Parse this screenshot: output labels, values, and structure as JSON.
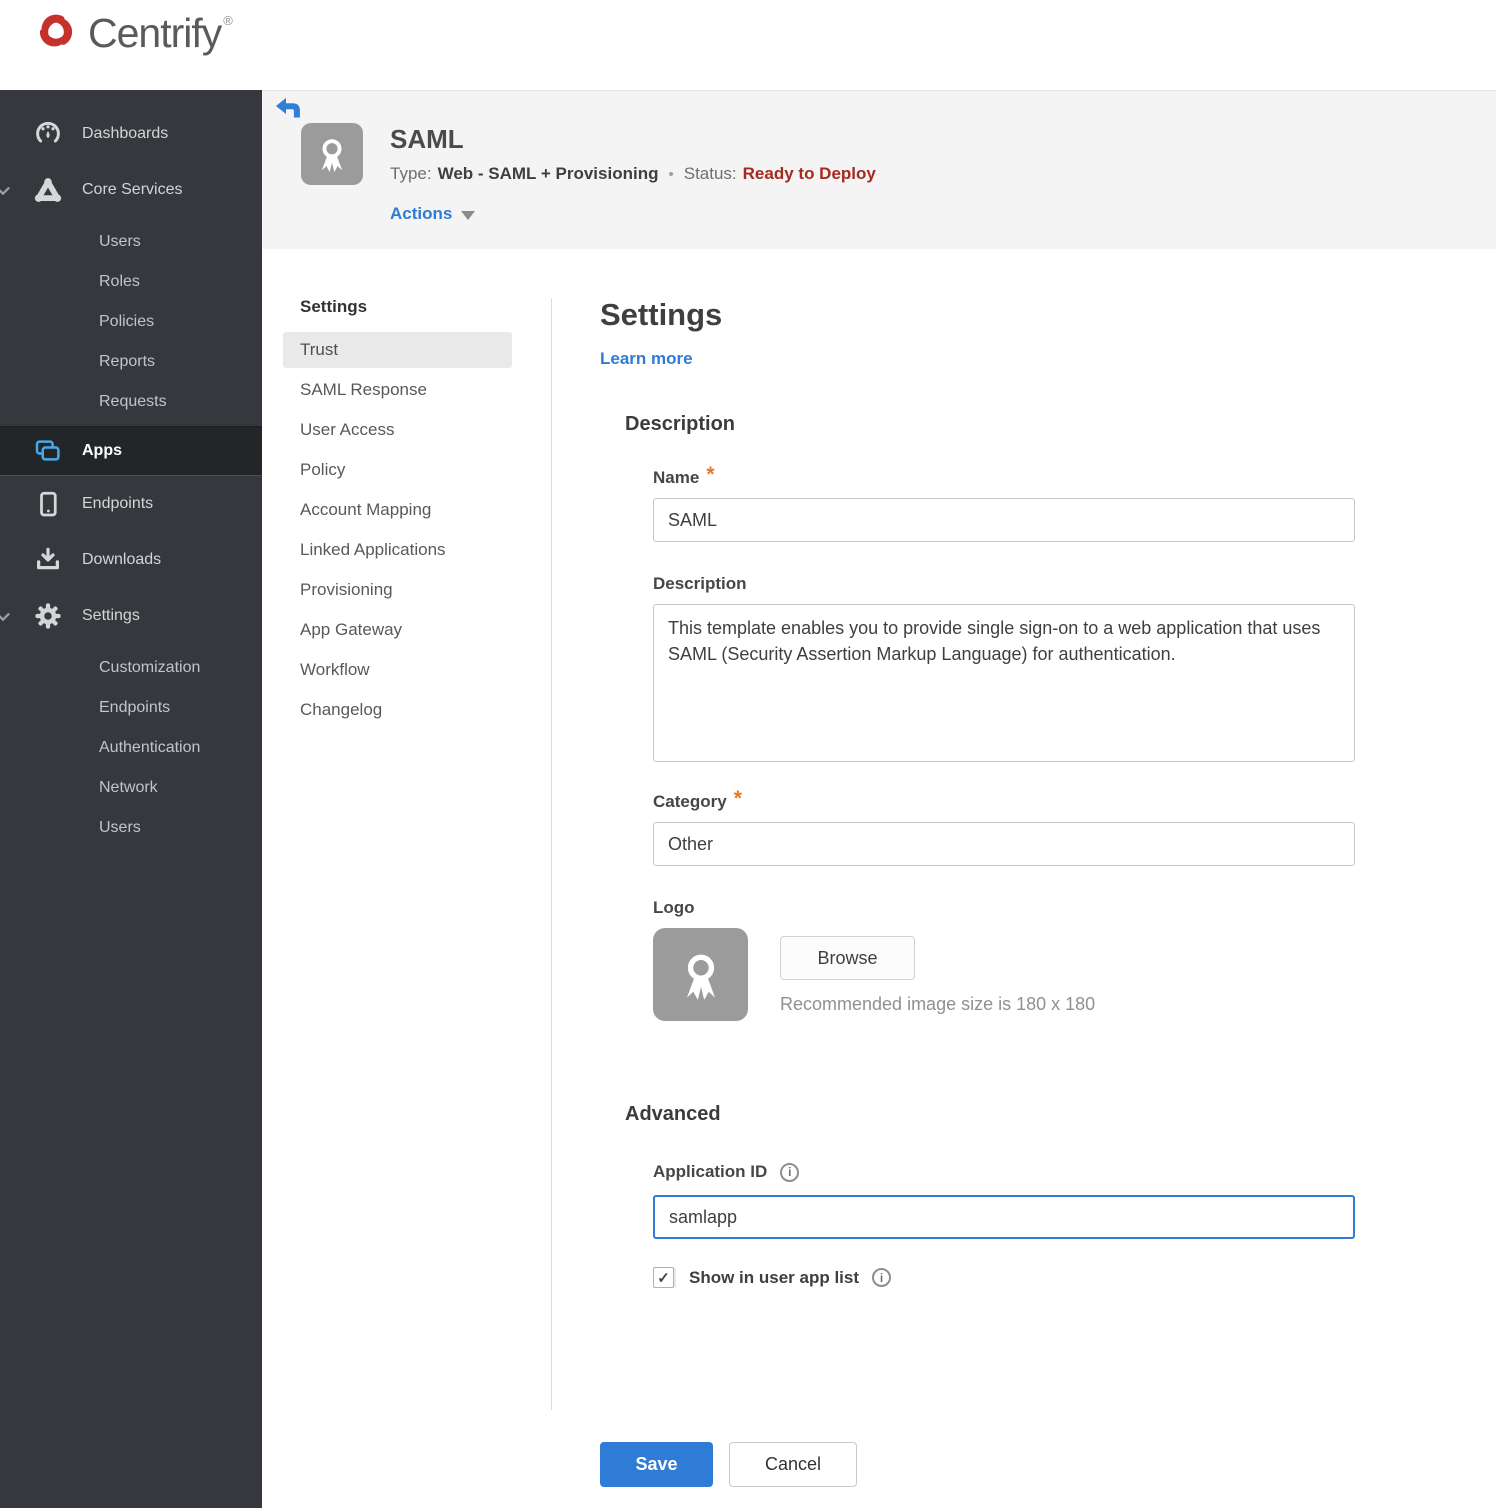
{
  "brand": {
    "name": "Centrify",
    "registered_mark": "®"
  },
  "sidebar": {
    "items": [
      {
        "label": "Dashboards",
        "icon": "gauge-icon"
      },
      {
        "label": "Core Services",
        "icon": "core-services-icon",
        "expanded": true
      },
      {
        "label": "Users"
      },
      {
        "label": "Roles"
      },
      {
        "label": "Policies"
      },
      {
        "label": "Reports"
      },
      {
        "label": "Requests"
      },
      {
        "label": "Apps",
        "icon": "apps-icon",
        "active": true
      },
      {
        "label": "Endpoints",
        "icon": "tablet-icon"
      },
      {
        "label": "Downloads",
        "icon": "download-icon"
      },
      {
        "label": "Settings",
        "icon": "gear-icon",
        "expanded": true
      },
      {
        "label": "Customization"
      },
      {
        "label": "Endpoints"
      },
      {
        "label": "Authentication"
      },
      {
        "label": "Network"
      },
      {
        "label": "Users"
      }
    ]
  },
  "app_header": {
    "title": "SAML",
    "type_label": "Type:",
    "type_value": "Web - SAML + Provisioning",
    "separator": "•",
    "status_label": "Status:",
    "status_value": "Ready to Deploy",
    "actions_label": "Actions"
  },
  "subnav": {
    "header": "Settings",
    "items": [
      {
        "label": "Trust",
        "selected": true
      },
      {
        "label": "SAML Response"
      },
      {
        "label": "User Access"
      },
      {
        "label": "Policy"
      },
      {
        "label": "Account Mapping"
      },
      {
        "label": "Linked Applications"
      },
      {
        "label": "Provisioning"
      },
      {
        "label": "App Gateway"
      },
      {
        "label": "Workflow"
      },
      {
        "label": "Changelog"
      }
    ]
  },
  "form": {
    "title": "Settings",
    "learn_more": "Learn more",
    "required_mark": "*",
    "description_section": "Description",
    "name_label": "Name",
    "name_value": "SAML",
    "description_label": "Description",
    "description_value": "This template enables you to provide single sign-on to a web application that uses SAML (Security Assertion Markup Language) for authentication.",
    "category_label": "Category",
    "category_value": "Other",
    "logo_label": "Logo",
    "browse_label": "Browse",
    "recommended_text": "Recommended image size is 180 x 180",
    "advanced_section": "Advanced",
    "application_id_label": "Application ID",
    "application_id_value": "samlapp",
    "show_in_user_app_list_label": "Show in user app list",
    "show_in_user_app_list_checked": true,
    "save_label": "Save",
    "cancel_label": "Cancel"
  },
  "colors": {
    "accent_blue": "#2e7cd6",
    "status_red": "#a52a1f",
    "sidebar_active_icon_blue": "#4aa8e8",
    "required_orange": "#ee7623",
    "brand_red": "#c5322c"
  }
}
